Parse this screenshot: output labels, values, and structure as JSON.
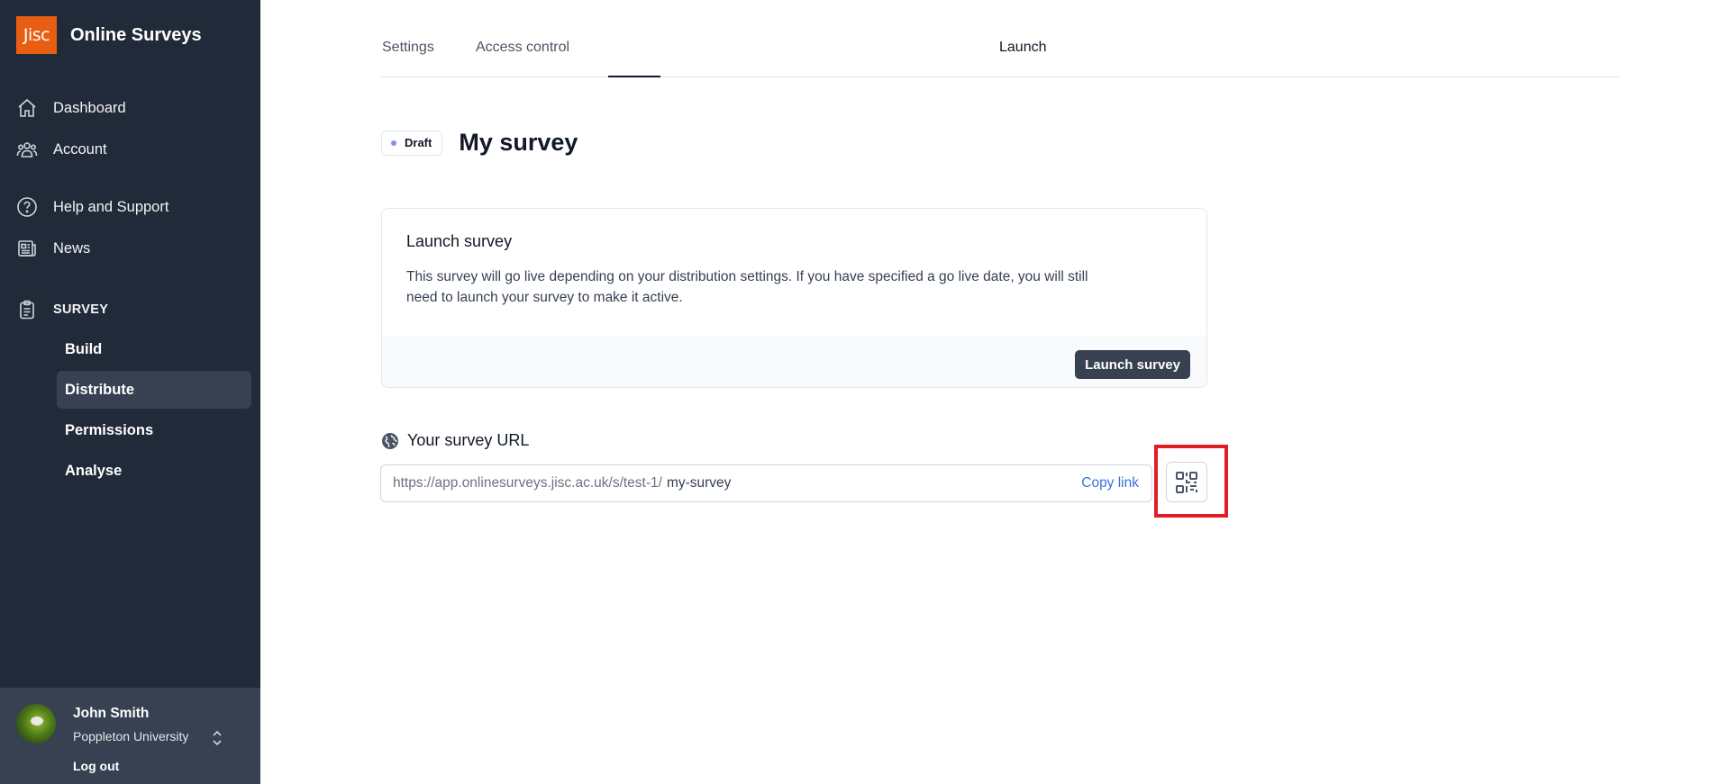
{
  "brand": {
    "logo_text": "Jisc",
    "name": "Online Surveys",
    "logo_color": "#e85e13"
  },
  "sidebar": {
    "nav": [
      {
        "label": "Dashboard",
        "icon": "home-icon"
      },
      {
        "label": "Account",
        "icon": "users-icon"
      },
      {
        "label": "Help and Support",
        "icon": "question-circle-icon"
      },
      {
        "label": "News",
        "icon": "newspaper-icon"
      }
    ],
    "section": {
      "label": "SURVEY",
      "icon": "clipboard-icon"
    },
    "sub_items": [
      {
        "label": "Build",
        "active": false
      },
      {
        "label": "Distribute",
        "active": true
      },
      {
        "label": "Permissions",
        "active": false
      },
      {
        "label": "Analyse",
        "active": false
      }
    ],
    "user": {
      "name": "John Smith",
      "org": "Poppleton University",
      "logout": "Log out"
    }
  },
  "tabs": [
    {
      "label": "Settings",
      "active": false
    },
    {
      "label": "Access control",
      "active": false
    },
    {
      "label": "Launch",
      "active": true
    }
  ],
  "header": {
    "status_badge": "Draft",
    "title": "My survey"
  },
  "launch_card": {
    "title": "Launch survey",
    "text": "This survey will go live depending on your distribution settings. If you have specified a go live date, you will still need to launch your survey to make it active.",
    "button": "Launch survey"
  },
  "survey_url": {
    "heading": "Your survey URL",
    "prefix": "https://app.onlinesurveys.jisc.ac.uk/s/test-1/",
    "slug": "my-survey",
    "copy_label": "Copy link",
    "qr_icon": "qr-code-icon"
  },
  "colors": {
    "sidebar_bg": "#212a38",
    "accent": "#e85e13",
    "highlight": "#e11d28"
  }
}
